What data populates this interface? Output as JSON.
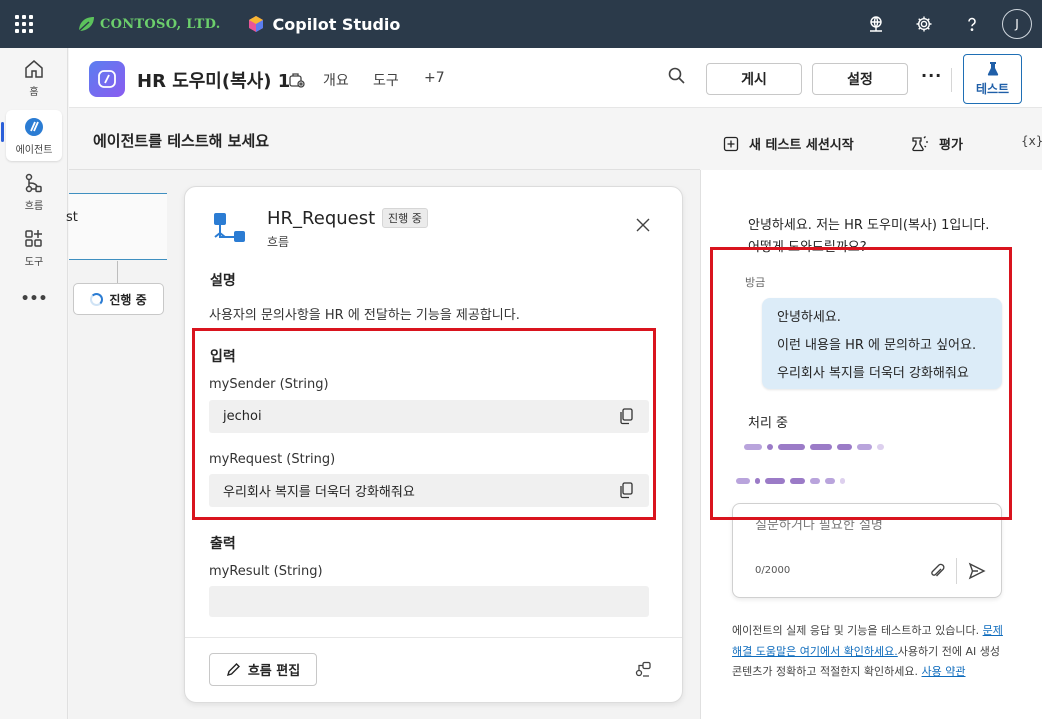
{
  "topbar": {
    "brand": "CONTOSO, LTD.",
    "product": "Copilot Studio",
    "avatar_initial": "J",
    "icons": [
      "waffle-icon",
      "environment-icon",
      "settings-icon",
      "help-icon"
    ]
  },
  "rail": {
    "items": [
      {
        "label": "홈",
        "icon": "home-icon"
      },
      {
        "label": "에이전트",
        "icon": "agents-icon"
      },
      {
        "label": "흐름",
        "icon": "flows-icon"
      },
      {
        "label": "도구",
        "icon": "tools-icon"
      },
      {
        "label": "•••",
        "icon": "more-icon"
      }
    ]
  },
  "header": {
    "agent_title": "HR 도우미(복사) 1",
    "tabs": [
      "개요",
      "도구",
      "+7"
    ],
    "publish_label": "게시",
    "settings_label": "설정",
    "more_label": "···",
    "test_label": "테스트"
  },
  "canvas": {
    "title": "에이전트를 테스트해 보세요",
    "node_fragment": "st",
    "running_label": "진행 중"
  },
  "card": {
    "title": "HR_Request",
    "status": "진행 중",
    "subtitle": "흐름",
    "desc_heading": "설명",
    "description": "사용자의 문의사항을 HR 에 전달하는 기능을 제공합니다.",
    "inputs_heading": "입력",
    "inputs": [
      {
        "label": "mySender (String)",
        "value": "jechoi"
      },
      {
        "label": "myRequest (String)",
        "value": "우리회사 복지를 더욱더 강화해줘요"
      }
    ],
    "outputs_heading": "출력",
    "outputs": [
      {
        "label": "myResult (String)",
        "value": ""
      }
    ],
    "edit_flow_label": "흐름 편집"
  },
  "test_panel": {
    "new_session_label": "새 테스트 세션시작",
    "evaluate_label": "평가",
    "variables_label": "{x}",
    "greeting": "안녕하세요. 저는 HR 도우미(복사) 1입니다. 어떻게 도와드릴까요?",
    "timestamp": "방금",
    "user_lines": [
      "안녕하세요.",
      "이런 내용을 HR 에 문의하고 싶어요.",
      "우리회사 복지를 더욱더 강화해줘요"
    ],
    "processing_label": "처리 중",
    "input_placeholder": "질문하거나 필요한 설명",
    "char_counter": "0/2000",
    "disclaimer_pre": "에이전트의 실제 응답 및 기능을 테스트하고 있습니다. ",
    "disclaimer_link1": "문제 해결 도움말은 여기에서 확인하세요.",
    "disclaimer_mid": "사용하기 전에 AI 생성 콘텐츠가 정확하고 적절한지 확인하세요. ",
    "disclaimer_link2": "사용 약관"
  },
  "colors": {
    "topbar": "#2b3a4a",
    "highlight_box": "#d9141e",
    "user_bubble": "#dcecf8",
    "accent": "#0f6cbd"
  }
}
